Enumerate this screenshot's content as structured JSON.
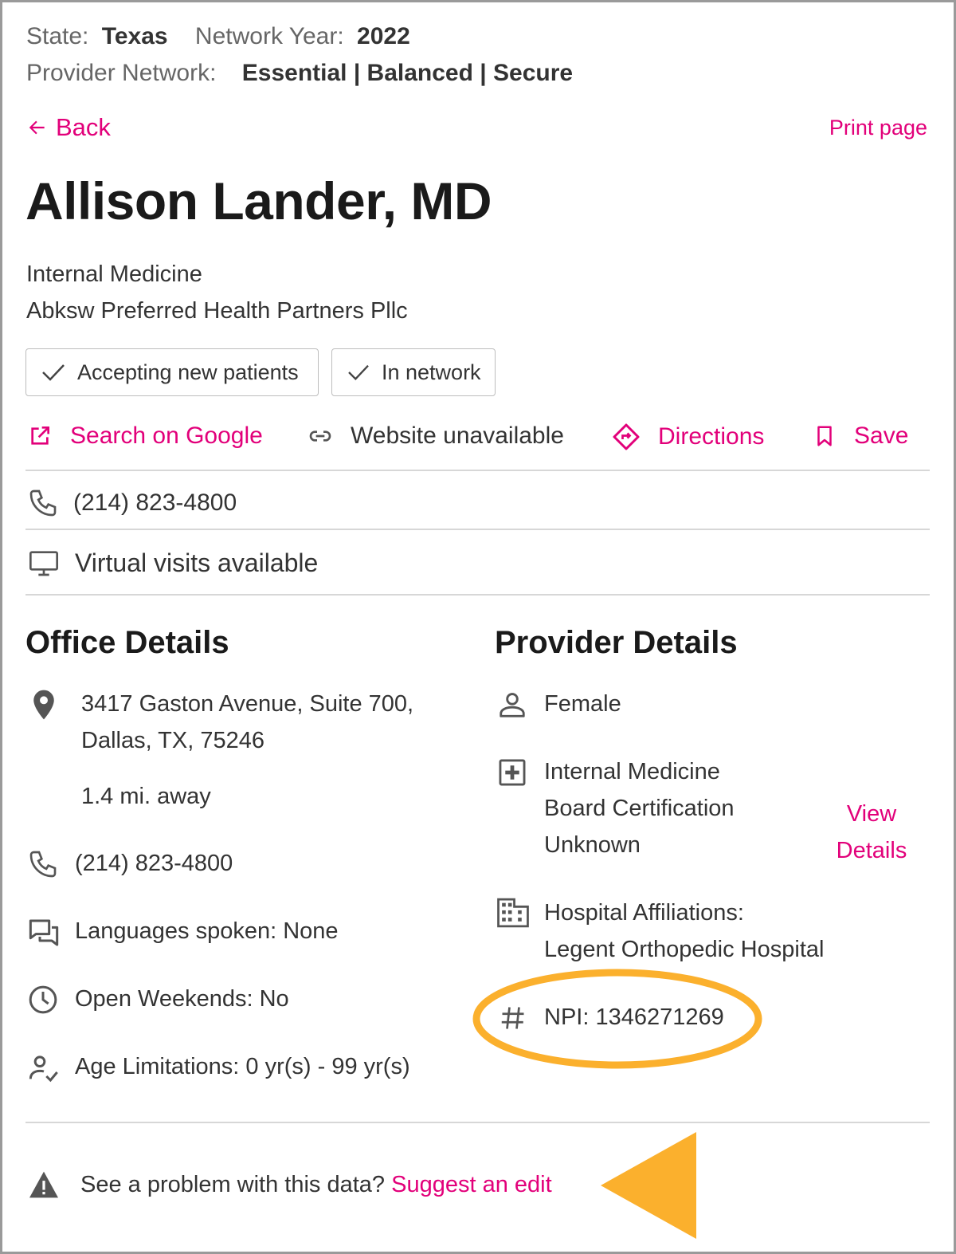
{
  "header": {
    "state_label": "State:",
    "state_value": "Texas",
    "year_label": "Network Year:",
    "year_value": "2022",
    "network_label": "Provider Network:",
    "network_value": "Essential | Balanced | Secure"
  },
  "nav": {
    "back_label": "Back",
    "print_label": "Print page"
  },
  "provider": {
    "name": "Allison Lander, MD",
    "specialty": "Internal Medicine",
    "practice": "Abksw Preferred Health Partners Pllc",
    "badges": [
      "Accepting new patients",
      "In network"
    ]
  },
  "actions": {
    "search_google": "Search on Google",
    "website": "Website unavailable",
    "directions": "Directions",
    "save": "Save"
  },
  "contact": {
    "phone": "(214) 823-4800",
    "virtual": "Virtual visits available"
  },
  "office": {
    "heading": "Office Details",
    "address_line1": "3417 Gaston Avenue, Suite 700,",
    "address_line2": "Dallas, TX, 75246",
    "distance": "1.4 mi. away",
    "phone": "(214) 823-4800",
    "languages": "Languages spoken: None",
    "weekends": "Open Weekends: No",
    "age_limits": "Age Limitations: 0 yr(s) - 99 yr(s)"
  },
  "provider_details": {
    "heading": "Provider Details",
    "gender": "Female",
    "cert_line1": "Internal Medicine",
    "cert_line2": "Board Certification",
    "cert_line3": "Unknown",
    "view_details_1": "View",
    "view_details_2": "Details",
    "hospital_line1": "Hospital Affiliations:",
    "hospital_line2": "Legent Orthopedic Hospital",
    "npi": "NPI: 1346271269"
  },
  "footer": {
    "problem_text": "See a problem with this data?",
    "suggest_link": "Suggest an edit"
  },
  "colors": {
    "accent": "#e2007a",
    "annotation": "#fbb02d",
    "text": "#333333",
    "muted": "#666666"
  },
  "icons": {
    "back": "arrow-left-icon",
    "check": "check-icon",
    "external": "external-link-icon",
    "link": "link-icon",
    "directions": "directions-icon",
    "bookmark": "bookmark-icon",
    "phone": "phone-icon",
    "monitor": "monitor-icon",
    "location": "location-pin-icon",
    "chat": "chat-icon",
    "clock": "clock-icon",
    "person": "person-icon",
    "person_check": "person-check-icon",
    "medical": "medical-plus-icon",
    "building": "building-icon",
    "hash": "hash-icon",
    "warning": "warning-icon"
  }
}
